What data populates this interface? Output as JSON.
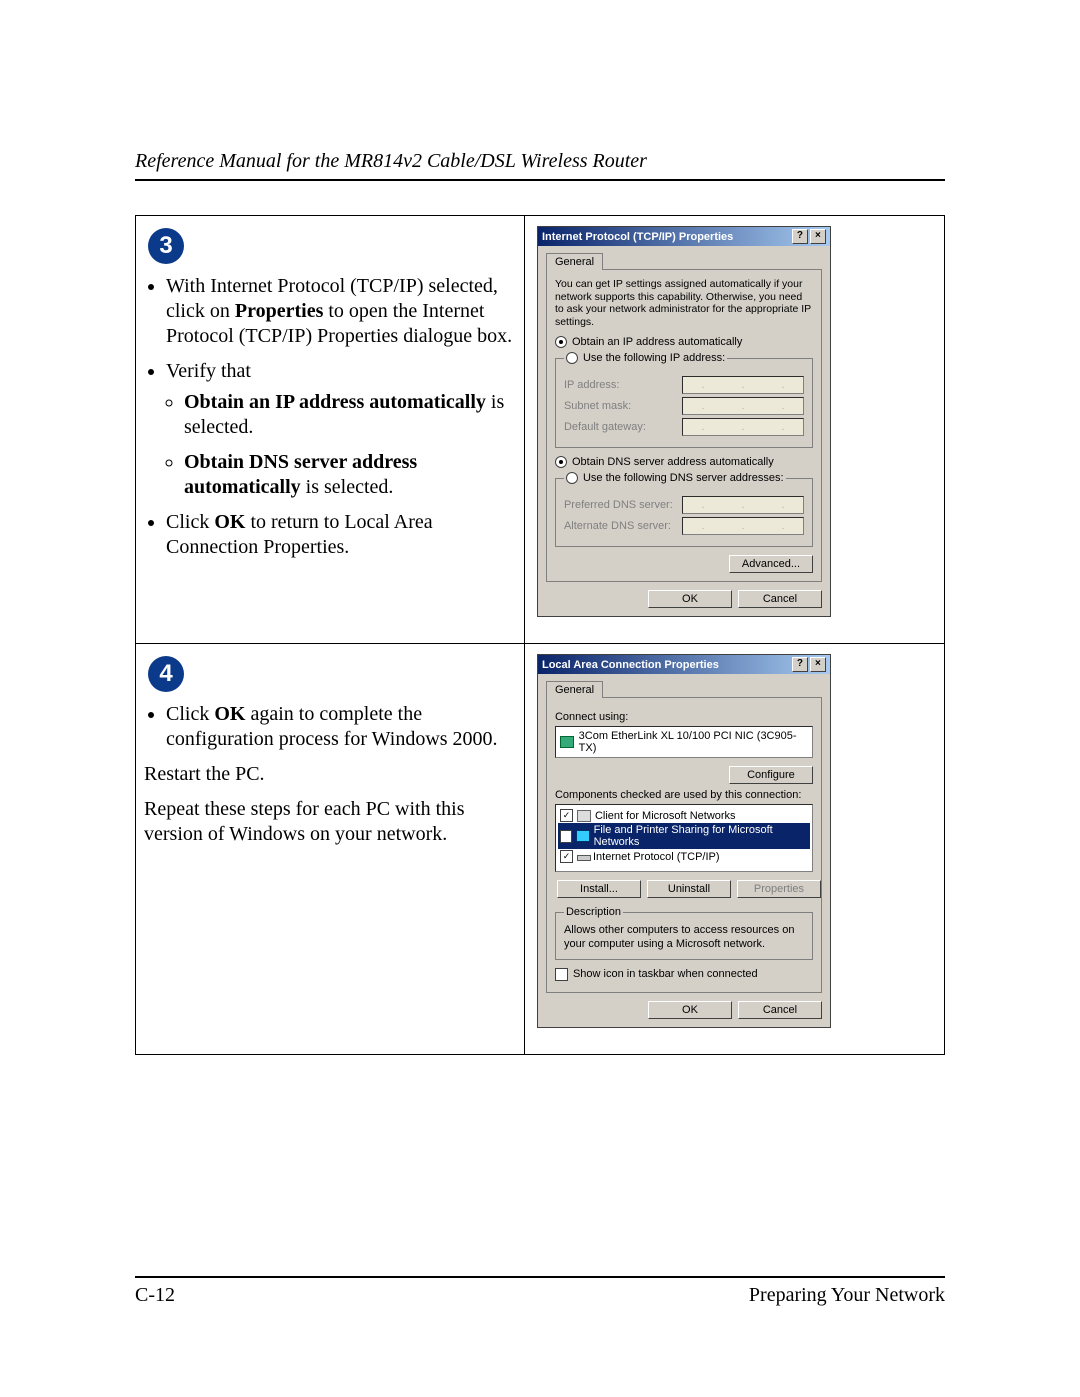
{
  "header": {
    "running_title": "Reference Manual for the MR814v2 Cable/DSL Wireless Router"
  },
  "footer": {
    "page_number": "C-12",
    "section": "Preparing Your Network"
  },
  "steps": {
    "step3": {
      "badge": "3",
      "bullet1_pre": "With Internet Protocol (TCP/IP) selected, click on ",
      "bullet1_bold": "Properties",
      "bullet1_post": " to open the Internet Protocol (TCP/IP) Properties dialogue box.",
      "bullet2": "Verify that",
      "sub1_bold": "Obtain an IP address automatically",
      "sub1_post": " is selected.",
      "sub2_bold": "Obtain DNS server address automatically",
      "sub2_post": " is selected.",
      "bullet3_pre": "Click ",
      "bullet3_bold": "OK",
      "bullet3_post": " to return to Local Area Connection Properties."
    },
    "step4": {
      "badge": "4",
      "bullet1_pre": "Click ",
      "bullet1_bold": "OK",
      "bullet1_post": " again to complete the configuration process for Windows 2000.",
      "para1": "Restart the PC.",
      "para2": "Repeat these steps for each PC with this version of Windows on your network."
    }
  },
  "dialog_tcp": {
    "title": "Internet Protocol (TCP/IP) Properties",
    "help_btn": "?",
    "close_btn": "×",
    "tab": "General",
    "description": "You can get IP settings assigned automatically if your network supports this capability. Otherwise, you need to ask your network administrator for the appropriate IP settings.",
    "r_obtain_ip": "Obtain an IP address automatically",
    "r_use_ip": "Use the following IP address:",
    "lbl_ip": "IP address:",
    "lbl_subnet": "Subnet mask:",
    "lbl_gateway": "Default gateway:",
    "r_obtain_dns": "Obtain DNS server address automatically",
    "r_use_dns": "Use the following DNS server addresses:",
    "lbl_pref_dns": "Preferred DNS server:",
    "lbl_alt_dns": "Alternate DNS server:",
    "btn_advanced": "Advanced...",
    "btn_ok": "OK",
    "btn_cancel": "Cancel"
  },
  "dialog_lan": {
    "title": "Local Area Connection Properties",
    "help_btn": "?",
    "close_btn": "×",
    "tab": "General",
    "lbl_connect_using": "Connect using:",
    "nic": "3Com EtherLink XL 10/100 PCI NIC (3C905-TX)",
    "btn_configure": "Configure",
    "lbl_components": "Components checked are used by this connection:",
    "items": {
      "client": "Client for Microsoft Networks",
      "share": "File and Printer Sharing for Microsoft Networks",
      "tcp": "Internet Protocol (TCP/IP)"
    },
    "btn_install": "Install...",
    "btn_uninstall": "Uninstall",
    "btn_properties": "Properties",
    "grp_desc": "Description",
    "desc_text": "Allows other computers to access resources on your computer using a Microsoft network.",
    "chk_showicon": "Show icon in taskbar when connected",
    "btn_ok": "OK",
    "btn_cancel": "Cancel"
  }
}
